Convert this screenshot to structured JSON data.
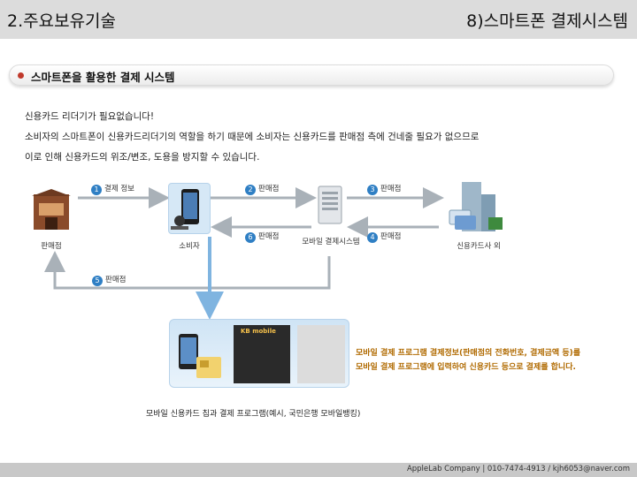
{
  "header": {
    "chapter": "2.주요보유기술",
    "subtitle": "8)스마트폰 결제시스템"
  },
  "section": {
    "title": "스마트폰을 활용한 결제 시스템"
  },
  "description": [
    "신용카드 리더기가 필요없습니다!",
    "소비자의 스마트폰이 신용카드리더기의 역할을 하기 때문에 소비자는 신용카드를 판매점 측에 건네줄 필요가 없으므로",
    "이로 인해 신용카드의 위조/변조, 도용을 방지할 수 있습니다."
  ],
  "diagram": {
    "nodes": {
      "merchant": "판매점",
      "consumer": "소비자",
      "payment_system": "모바일 결제시스템",
      "card_company": "신용카드사 외"
    },
    "steps": [
      {
        "num": "1",
        "label": "결제 정보"
      },
      {
        "num": "2",
        "label": "판매점"
      },
      {
        "num": "3",
        "label": "판매점"
      },
      {
        "num": "4",
        "label": "판매점"
      },
      {
        "num": "5",
        "label": "판매점"
      },
      {
        "num": "6",
        "label": "판매점"
      }
    ],
    "app_brand": "KB mobile",
    "notes": [
      "모바일 결제 프로그램 결제정보(판매점의 전화번호, 결제금액 등)를",
      "모바일 결제 프로그램에 입력하여 신용카드 등으로 결제를 합니다."
    ],
    "caption": "모바일 신용카드 칩과 결제 프로그램(예시, 국민은행 모바일뱅킹)"
  },
  "footer": {
    "text": "AppleLab Company | 010-7474-4913 / kjh6053@naver.com"
  },
  "colors": {
    "arrow": "#a9b1b8",
    "bottom_arrow": "#7fb4e0",
    "step_badge": "#2f7fc4",
    "note": "#b06a00"
  }
}
